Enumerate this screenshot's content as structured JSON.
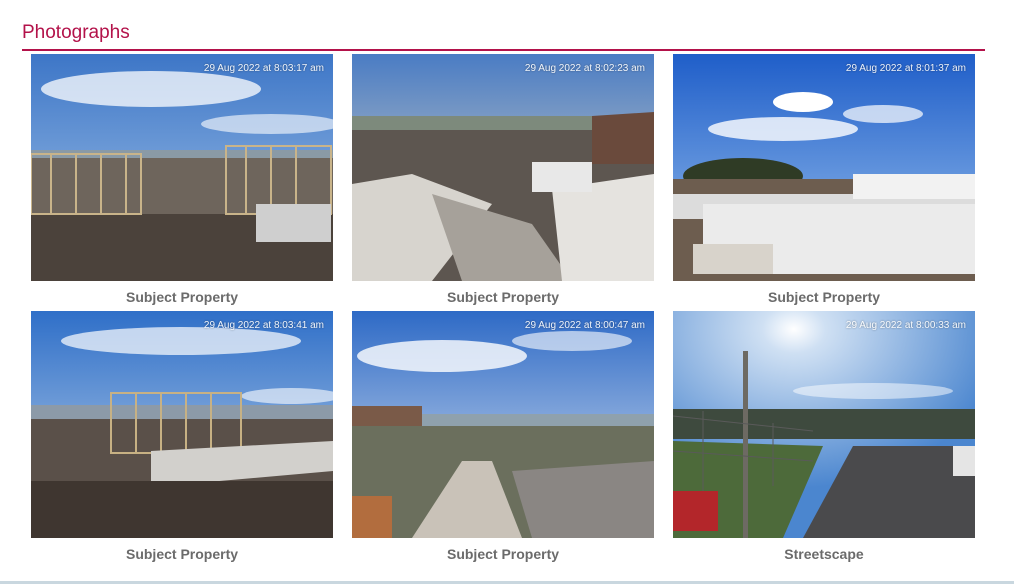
{
  "section": {
    "title": "Photographs"
  },
  "photos": [
    {
      "timestamp": "29 Aug 2022 at 8:03:17 am",
      "caption": "Subject Property"
    },
    {
      "timestamp": "29 Aug 2022 at 8:02:23 am",
      "caption": "Subject Property"
    },
    {
      "timestamp": "29 Aug 2022 at 8:01:37 am",
      "caption": "Subject Property"
    },
    {
      "timestamp": "29 Aug 2022 at 8:03:41 am",
      "caption": "Subject Property"
    },
    {
      "timestamp": "29 Aug 2022 at 8:00:47 am",
      "caption": "Subject Property"
    },
    {
      "timestamp": "29 Aug 2022 at 8:00:33 am",
      "caption": "Streetscape"
    }
  ],
  "colors": {
    "accent": "#b3124a",
    "caption": "#6b6b6b"
  }
}
